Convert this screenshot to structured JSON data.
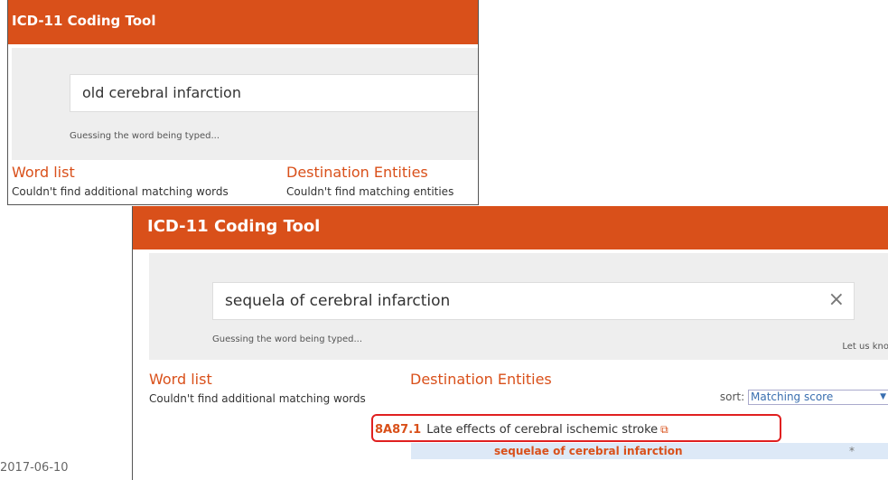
{
  "panel1": {
    "title": "ICD-11 Coding Tool",
    "search_value": "old cerebral infarction",
    "hint": "Guessing the word being typed...",
    "word_list_title": "Word list",
    "word_list_text": "Couldn't find additional matching words",
    "entities_title": "Destination Entities",
    "entities_text": "Couldn't find matching entities"
  },
  "panel2": {
    "title": "ICD-11 Coding Tool",
    "search_value": "sequela of cerebral infarction",
    "clear_icon": "×",
    "hint": "Guessing the word being typed...",
    "let_us_know": "Let us kno",
    "word_list_title": "Word list",
    "word_list_text": "Couldn't find additional matching words",
    "entities_title": "Destination Entities",
    "sort_label": "sort:",
    "sort_value": "Matching score",
    "result": {
      "code": "8A87.1",
      "label": "Late effects of cerebral ischemic stroke",
      "ext_icon": "⧉"
    },
    "match": {
      "text": "sequelae of cerebral infarction",
      "star": "*"
    }
  },
  "date": "2017-06-10",
  "colors": {
    "brand": "#d9501a",
    "highlight_border": "#e02020",
    "match_bg": "#dde9f7"
  }
}
